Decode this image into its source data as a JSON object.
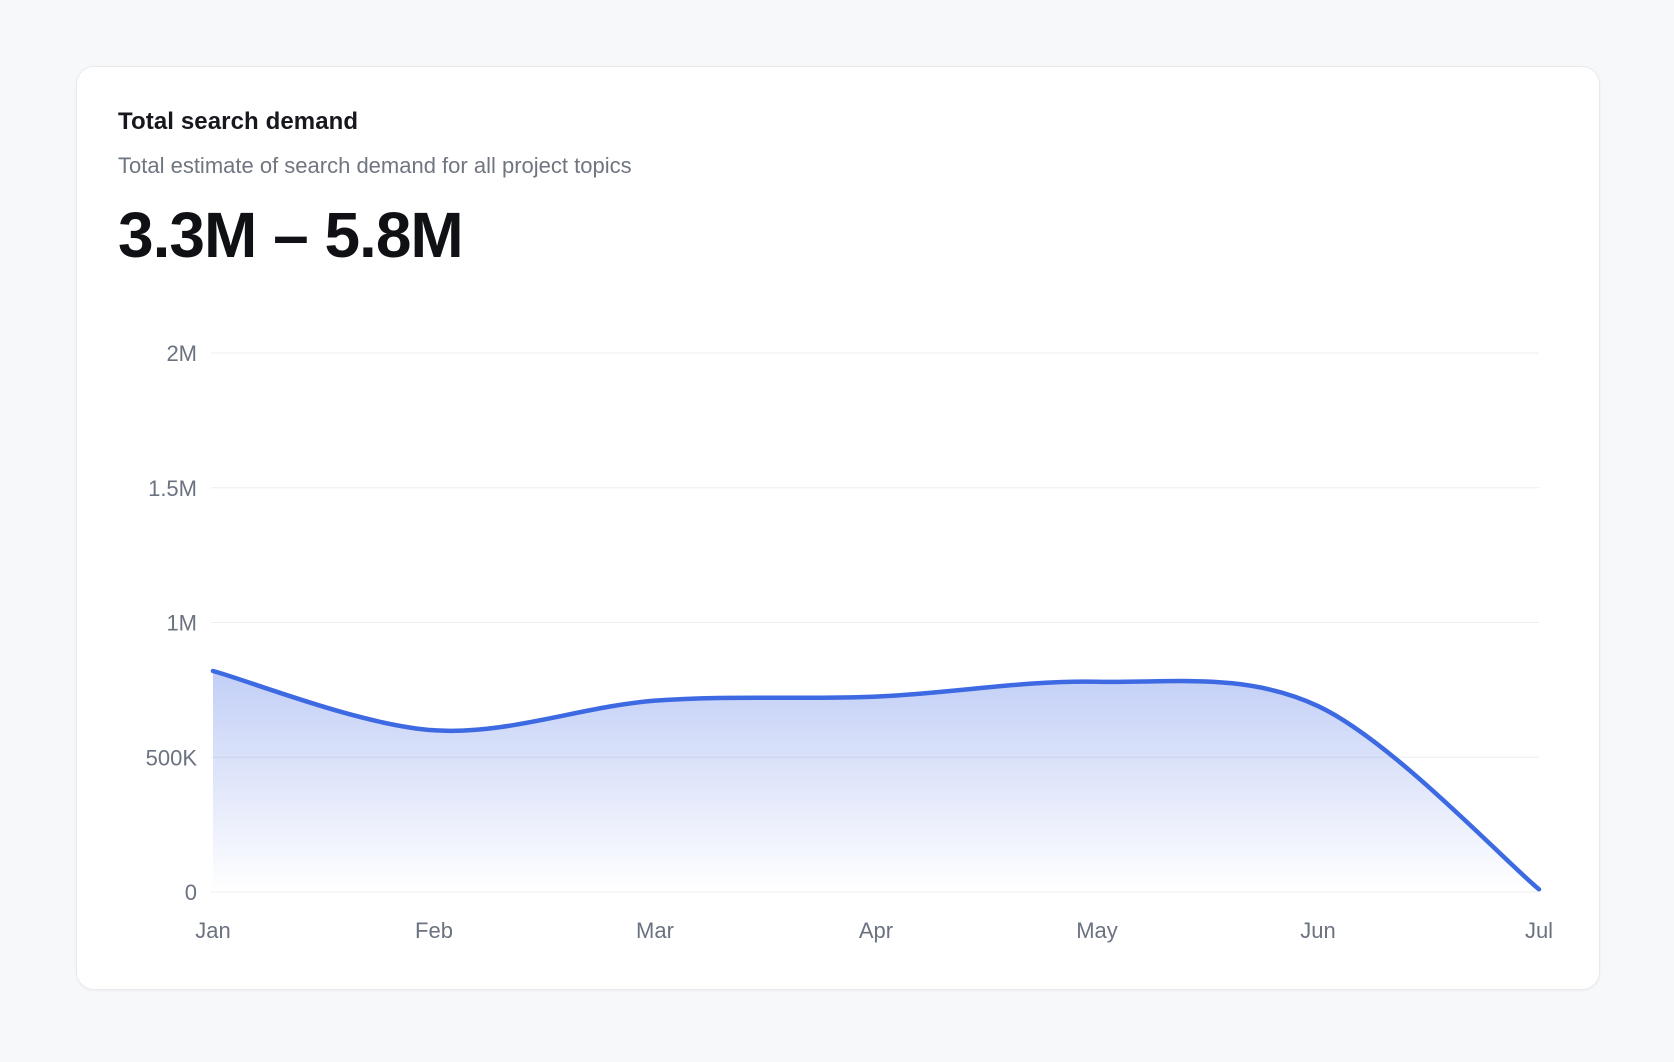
{
  "page": {
    "background_color": "#f7f8fa"
  },
  "card": {
    "title": "Total search demand",
    "subtitle": "Total estimate of search demand for all project topics",
    "headline_range": "3.3M – 5.8M"
  },
  "chart_data": {
    "type": "area",
    "title": "Total search demand",
    "categories": [
      "Jan",
      "Feb",
      "Mar",
      "Apr",
      "May",
      "Jun",
      "Jul"
    ],
    "series": [
      {
        "name": "Total search demand",
        "values": [
          820000,
          600000,
          710000,
          725000,
          780000,
          690000,
          10000
        ]
      }
    ],
    "xlabel": "",
    "ylabel": "",
    "ylim": [
      0,
      2000000
    ],
    "yticks": {
      "values": [
        0,
        500000,
        1000000,
        1500000,
        2000000
      ],
      "labels": [
        "0",
        "500K",
        "1M",
        "1.5M",
        "2M"
      ]
    },
    "grid": "horizontal",
    "legend": "none",
    "colors": {
      "line": "#3d6ae2",
      "area_top": "rgba(77, 114, 228, 0.42)",
      "area_bottom": "rgba(77, 114, 228, 0)",
      "grid_line": "#eceef0",
      "axis_label": "#6b7280"
    }
  }
}
